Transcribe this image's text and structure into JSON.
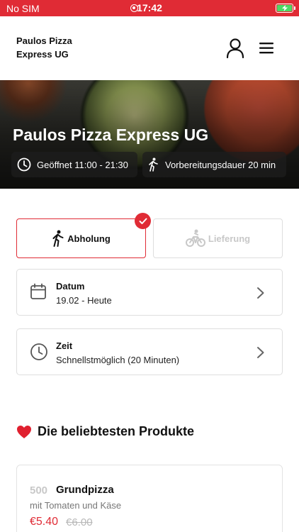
{
  "status_bar": {
    "carrier": "No SIM",
    "time": "17:42"
  },
  "header": {
    "brand": "Paulos Pizza Express UG",
    "user_icon": "user-icon",
    "menu_icon": "menu-icon"
  },
  "hero": {
    "title": "Paulos Pizza Express UG",
    "hours": "Geöffnet 11:00 - 21:30",
    "prep_time": "Vorbereitungsdauer 20 min"
  },
  "order_type": {
    "pickup": "Abholung",
    "delivery": "Lieferung",
    "selected": "pickup"
  },
  "date": {
    "label": "Datum",
    "value": "19.02 - Heute"
  },
  "time": {
    "label": "Zeit",
    "value": "Schnellstmöglich (20 Minuten)"
  },
  "popular": {
    "title": "Die beliebtesten Produkte",
    "products": [
      {
        "number": "500",
        "name": "Grundpizza",
        "description": "mit Tomaten und Käse",
        "price": "€5.40",
        "old_price": "€6.00"
      }
    ]
  },
  "colors": {
    "accent": "#e02b35",
    "border": "#dedede",
    "muted": "#c8c8c8"
  }
}
